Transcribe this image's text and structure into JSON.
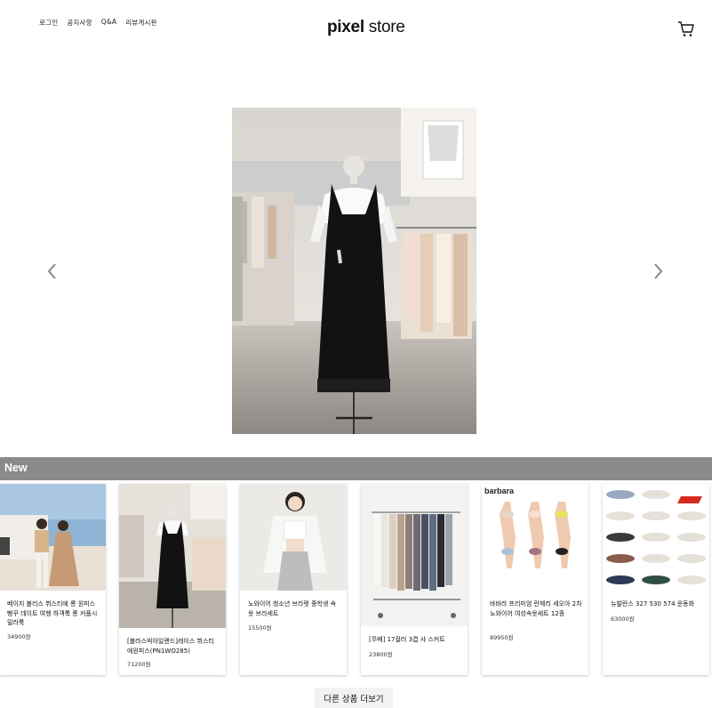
{
  "header": {
    "nav": [
      "로그인",
      "공지사항",
      "Q&A",
      "리뷰게시판"
    ],
    "logo_bold": "pixel",
    "logo_regular": " store",
    "cart_icon": "cart-icon"
  },
  "carousel": {
    "prev_icon": "chevron-left-icon",
    "next_icon": "chevron-right-icon"
  },
  "section": {
    "title": "New"
  },
  "products": [
    {
      "name": "베이지 볼리스 뷔스티에 롱 원피스 빵꾸 데이트 여행 하객룩 롱 커플시밀러룩",
      "price": "34900원"
    },
    {
      "name": "[블라스빅아일랜드]레이스 뷔스티에원피스(PN1WO285)",
      "price": "71200원"
    },
    {
      "name": "노와이어 청소년 브라렛 중학생 속옷 브라세트",
      "price": "15500원"
    },
    {
      "name": "[무배] 17컬러 3겹 샤 스커트",
      "price": "23800원"
    },
    {
      "name": "바바라 프리미엄 란제리 세오아 2차 노와이어 여성속옷세트 12종",
      "price": "89950원"
    },
    {
      "name": "뉴발란스 327 530 574 운동화",
      "price": "63000원"
    }
  ],
  "card4_brand": "barbara",
  "more_button": "다른 상품 더보기",
  "colors": {
    "section_bar": "#8a8a8a",
    "text": "#111111"
  }
}
